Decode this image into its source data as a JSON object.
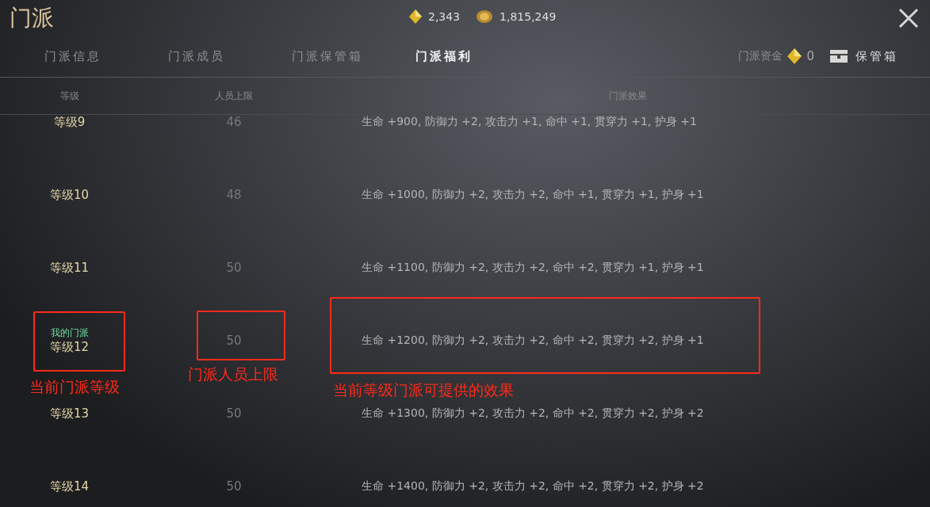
{
  "window": {
    "title": "门派"
  },
  "currencies": [
    {
      "kind": "gem",
      "amount": "2,343"
    },
    {
      "kind": "coin",
      "amount": "1,815,249"
    }
  ],
  "tabs": [
    {
      "label": "门派信息",
      "selected": false
    },
    {
      "label": "门派成员",
      "selected": false
    },
    {
      "label": "门派保管箱",
      "selected": false
    },
    {
      "label": "门派福利",
      "selected": true
    }
  ],
  "funds": {
    "label": "门派资金",
    "amount": "0"
  },
  "storage_button": {
    "label": "保管箱"
  },
  "table": {
    "columns": [
      "等级",
      "人员上限",
      "门派效果"
    ],
    "rows": [
      {
        "level": "等级9",
        "members": "46",
        "effect": "生命 +900, 防御力 +2, 攻击力 +1, 命中 +1, 贯穿力 +1, 护身 +1"
      },
      {
        "level": "等级10",
        "members": "48",
        "effect": "生命 +1000, 防御力 +2, 攻击力 +2, 命中 +1, 贯穿力 +1, 护身 +1"
      },
      {
        "level": "等级11",
        "members": "50",
        "effect": "生命 +1100, 防御力 +2, 攻击力 +2, 命中 +2, 贯穿力 +1, 护身 +1"
      },
      {
        "level": "等级12",
        "members": "50",
        "effect": "生命 +1200, 防御力 +2, 攻击力 +2, 命中 +2, 贯穿力 +2, 护身 +1",
        "badge": "我的门派"
      },
      {
        "level": "等级13",
        "members": "50",
        "effect": "生命 +1300, 防御力 +2, 攻击力 +2, 命中 +2, 贯穿力 +2, 护身 +2"
      },
      {
        "level": "等级14",
        "members": "50",
        "effect": "生命 +1400, 防御力 +2, 攻击力 +2, 命中 +2, 贯穿力 +2, 护身 +2"
      }
    ]
  },
  "annotations": [
    {
      "kind": "level",
      "label": "当前门派等级"
    },
    {
      "kind": "members",
      "label": "门派人员上限"
    },
    {
      "kind": "effect",
      "label": "当前等级门派可提供的效果"
    }
  ]
}
